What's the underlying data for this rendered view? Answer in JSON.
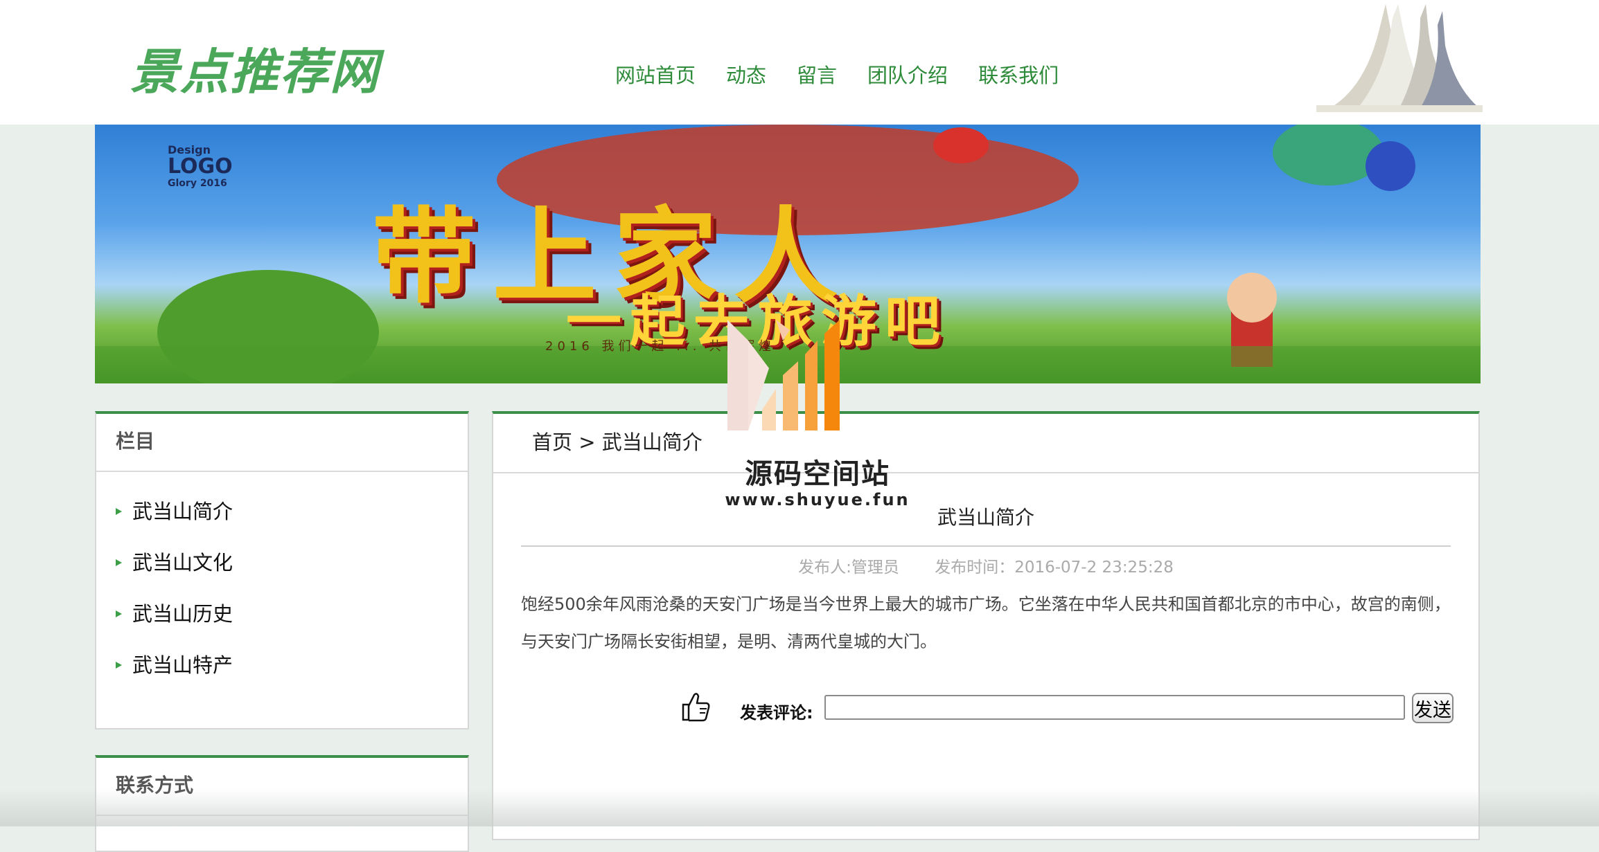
{
  "header": {
    "logo": "景点推荐网",
    "nav": [
      "网站首页",
      "动态",
      "留言",
      "团队介绍",
      "联系我们"
    ]
  },
  "banner": {
    "logo_lines": [
      "Design",
      "LOGO",
      "Glory 2016"
    ],
    "headline": "带上家人",
    "subline": "一起去旅游吧",
    "small_text": "2016 我们一起 ... 共创辉煌"
  },
  "sidebar": {
    "categories": {
      "title": "栏目",
      "items": [
        "武当山简介",
        "武当山文化",
        "武当山历史",
        "武当山特产"
      ]
    },
    "contact": {
      "title": "联系方式"
    }
  },
  "main": {
    "breadcrumb": {
      "home": "首页",
      "sep": " > ",
      "current": "武当山简介"
    },
    "article": {
      "title": "武当山简介",
      "author": "发布人:管理员",
      "time": "发布时间：2016-07-2 23:25:28",
      "body": "饱经500余年风雨沧桑的天安门广场是当今世界上最大的城市广场。它坐落在中华人民共和国首都北京的市中心，故宫的南侧，与天安门广场隔长安街相望，是明、清两代皇城的大门。"
    },
    "comment": {
      "label": "发表评论:",
      "input_value": "",
      "send_label": "发送"
    }
  },
  "watermark": {
    "name": "源码空间站",
    "url": "www.shuyue.fun"
  },
  "colors": {
    "accent_green": "#3c8f48",
    "nav_green": "#2e8b3a",
    "page_bg": "#e9efeb"
  }
}
